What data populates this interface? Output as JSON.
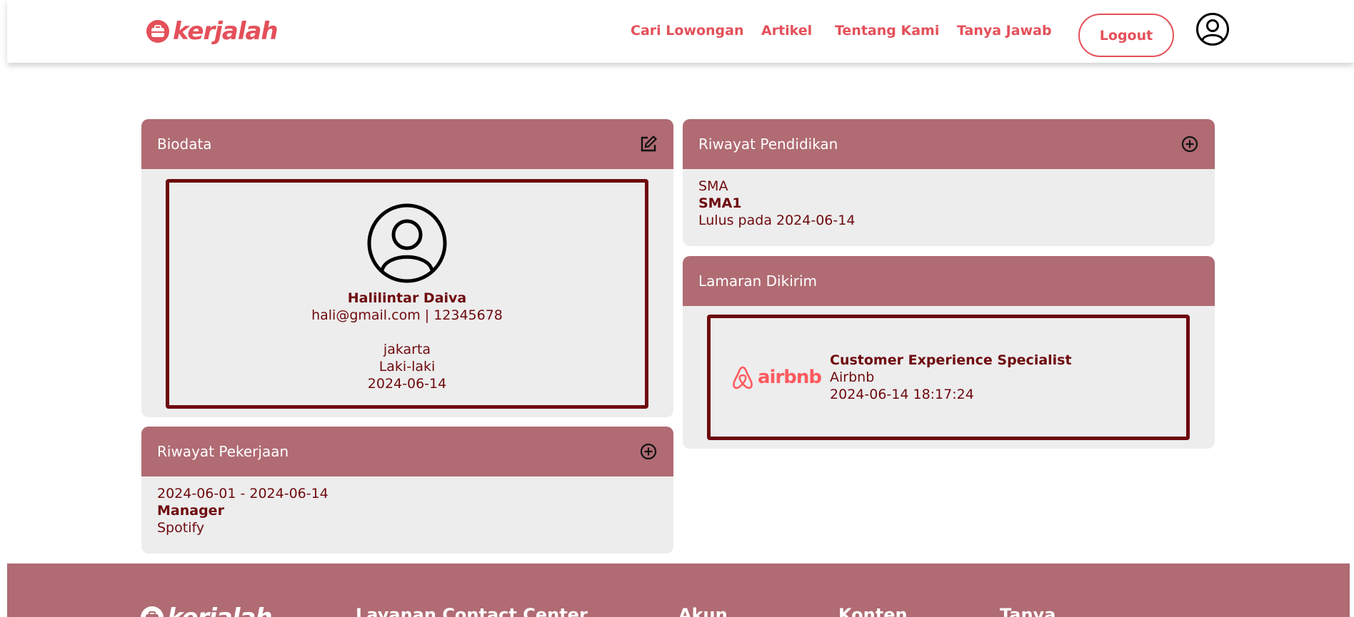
{
  "nav": {
    "logo": "kerjalah",
    "links": [
      "Cari Lowongan",
      "Artikel",
      "Tentang Kami",
      "Tanya Jawab"
    ],
    "logout": "Logout"
  },
  "biodata": {
    "title": "Biodata",
    "name": "Halilintar Daiva",
    "contact": "hali@gmail.com | 12345678",
    "city": "jakarta",
    "gender": "Laki-laki",
    "date": "2024-06-14"
  },
  "pekerjaan": {
    "title": "Riwayat Pekerjaan",
    "period": "2024-06-01 - 2024-06-14",
    "position": "Manager",
    "company": "Spotify"
  },
  "pendidikan": {
    "title": "Riwayat Pendidikan",
    "level": "SMA",
    "school": "SMA1",
    "graduated": "Lulus pada 2024-06-14"
  },
  "lamaran": {
    "title": "Lamaran Dikirim",
    "logo_text": "airbnb",
    "job": "Customer Experience Specialist",
    "company": "Airbnb",
    "sent": "2024-06-14 18:17:24"
  },
  "footer": {
    "logo": "kerjalah",
    "columns": [
      "Layanan Contact Center",
      "Akun",
      "Konten",
      "Tanya"
    ]
  },
  "colors": {
    "brand": "#e4505a",
    "header": "#b06b73",
    "dark_text": "#6e0a0e",
    "card_bg": "#ededed"
  }
}
